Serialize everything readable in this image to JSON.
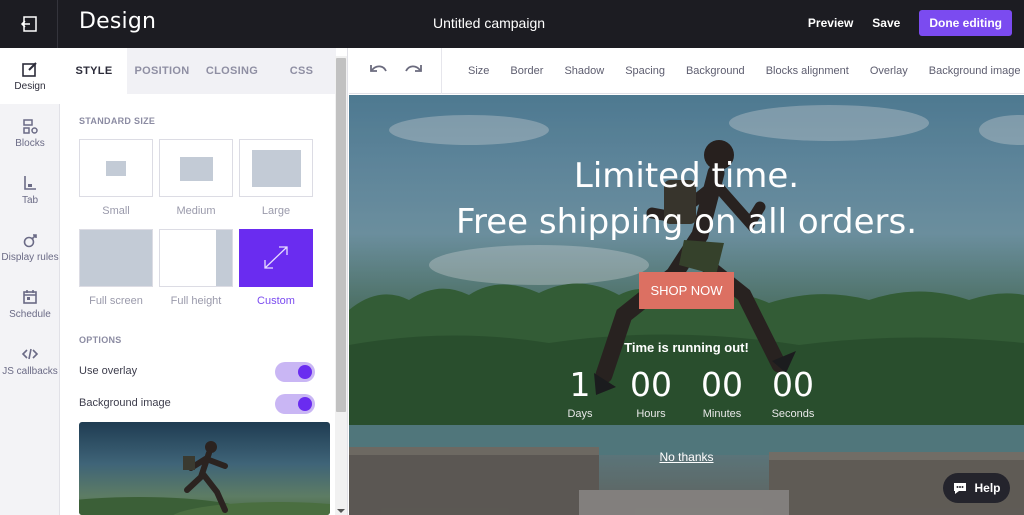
{
  "header": {
    "app_title": "Design",
    "campaign_name": "Untitled campaign",
    "preview_label": "Preview",
    "save_label": "Save",
    "done_label": "Done editing"
  },
  "rail": {
    "items": [
      {
        "label": "Design",
        "icon": "edit-icon"
      },
      {
        "label": "Blocks",
        "icon": "blocks-icon"
      },
      {
        "label": "Tab",
        "icon": "tab-icon"
      },
      {
        "label": "Display rules",
        "icon": "display-rules-icon"
      },
      {
        "label": "Schedule",
        "icon": "calendar-icon"
      },
      {
        "label": "JS callbacks",
        "icon": "code-icon"
      }
    ]
  },
  "panel": {
    "tabs": [
      "STYLE",
      "POSITION",
      "CLOSING",
      "CSS"
    ],
    "active_tab": "STYLE",
    "standard_size_label": "STANDARD SIZE",
    "sizes": [
      "Small",
      "Medium",
      "Large",
      "Full screen",
      "Full height",
      "Custom"
    ],
    "selected_size": "Custom",
    "options_label": "OPTIONS",
    "options": [
      {
        "label": "Use overlay",
        "enabled": true
      },
      {
        "label": "Background image",
        "enabled": true
      }
    ]
  },
  "toolbar": {
    "items": [
      "Size",
      "Border",
      "Shadow",
      "Spacing",
      "Background",
      "Blocks alignment",
      "Overlay",
      "Background image"
    ]
  },
  "popup": {
    "headline_1": "Limited time.",
    "headline_2": "Free shipping on all orders.",
    "cta_label": "SHOP NOW",
    "timer_title": "Time is running out!",
    "countdown": [
      {
        "value": "1",
        "label": "Days"
      },
      {
        "value": "00",
        "label": "Hours"
      },
      {
        "value": "00",
        "label": "Minutes"
      },
      {
        "value": "00",
        "label": "Seconds"
      }
    ],
    "dismiss_label": "No thanks"
  },
  "help": {
    "label": "Help"
  },
  "colors": {
    "accent": "#7b4bf0",
    "topbar": "#1c1c22",
    "cta": "#dc7062"
  }
}
